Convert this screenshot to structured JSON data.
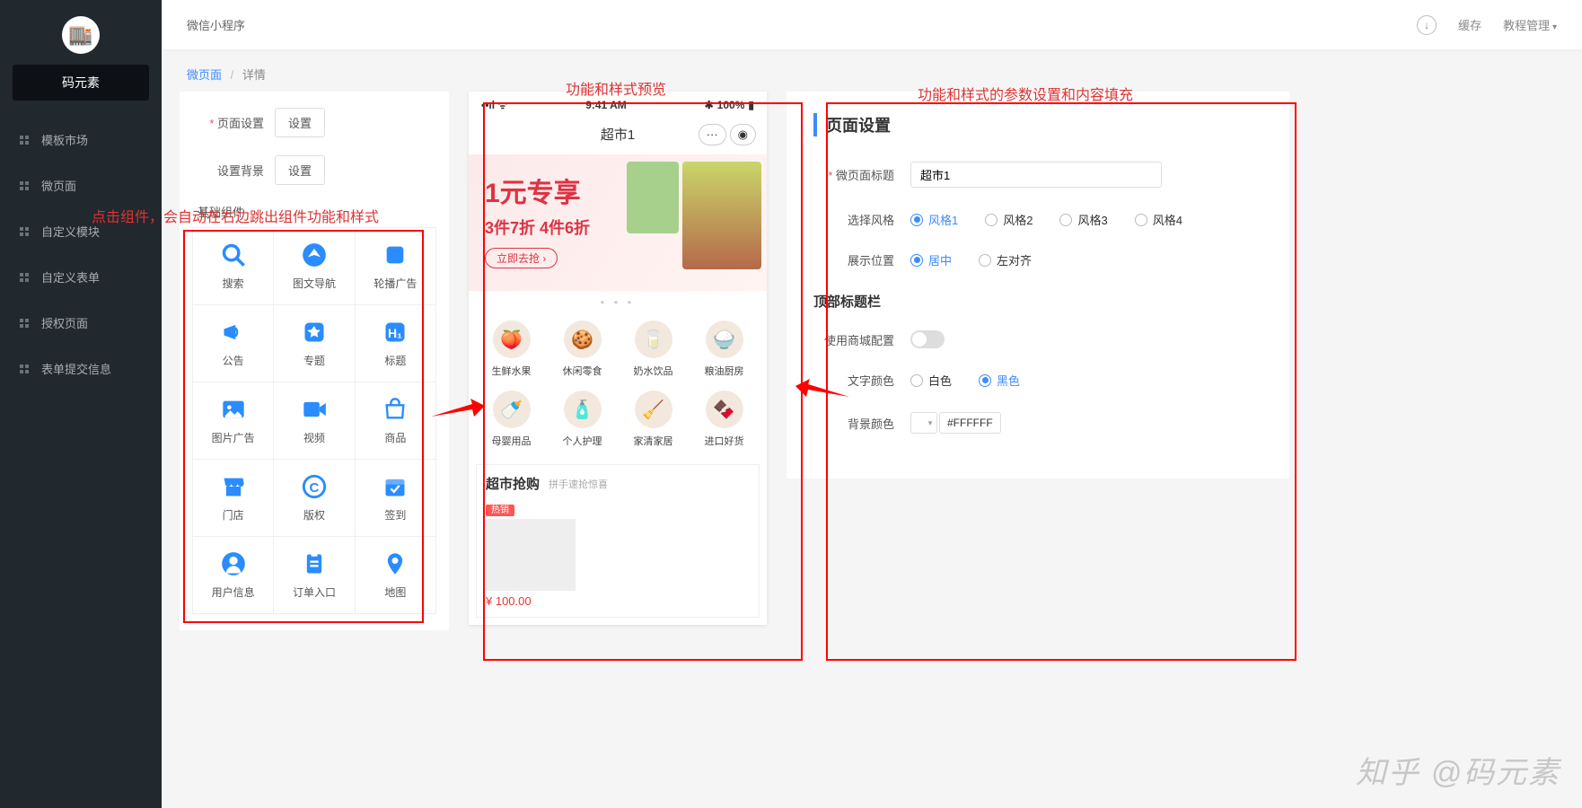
{
  "sidebar": {
    "brand": "码元素",
    "items": [
      {
        "label": "模板市场"
      },
      {
        "label": "微页面"
      },
      {
        "label": "自定义模块"
      },
      {
        "label": "自定义表单"
      },
      {
        "label": "授权页面"
      },
      {
        "label": "表单提交信息"
      }
    ]
  },
  "topbar": {
    "title": "微信小程序",
    "cache": "缓存",
    "tutorial": "教程管理"
  },
  "breadcrumb": {
    "link": "微页面",
    "current": "详情"
  },
  "leftForm": {
    "pageSettingLabel": "页面设置",
    "pageSettingBtn": "设置",
    "bgLabel": "设置背景",
    "bgBtn": "设置"
  },
  "annotations": {
    "click": "点击组件，会自动在右边跳出组件功能和样式",
    "preview": "功能和样式预览",
    "params": "功能和样式的参数设置和内容填充"
  },
  "componentsTitle": "基础组件",
  "components": [
    {
      "label": "搜索",
      "icon": "search"
    },
    {
      "label": "图文导航",
      "icon": "nav"
    },
    {
      "label": "轮播广告",
      "icon": "carousel"
    },
    {
      "label": "公告",
      "icon": "announce"
    },
    {
      "label": "专题",
      "icon": "star"
    },
    {
      "label": "标题",
      "icon": "heading"
    },
    {
      "label": "图片广告",
      "icon": "image"
    },
    {
      "label": "视频",
      "icon": "video"
    },
    {
      "label": "商品",
      "icon": "goods"
    },
    {
      "label": "门店",
      "icon": "store"
    },
    {
      "label": "版权",
      "icon": "copyright"
    },
    {
      "label": "签到",
      "icon": "checkin"
    },
    {
      "label": "用户信息",
      "icon": "user"
    },
    {
      "label": "订单入口",
      "icon": "order"
    },
    {
      "label": "地图",
      "icon": "map"
    }
  ],
  "phone": {
    "time": "9:41 AM",
    "battery": "100%",
    "title": "超市1",
    "bannerTitle": "1元专享",
    "bannerSub": "3件7折 4件6折",
    "bannerCta": "立即去抢 ›",
    "categories": [
      {
        "label": "生鲜水果"
      },
      {
        "label": "休闲零食"
      },
      {
        "label": "奶水饮品"
      },
      {
        "label": "粮油厨房"
      },
      {
        "label": "母婴用品"
      },
      {
        "label": "个人护理"
      },
      {
        "label": "家清家居"
      },
      {
        "label": "进口好货"
      }
    ],
    "promoTitle": "超市抢购",
    "promoSub": "拼手速抢惊喜",
    "badge": "热销",
    "price": "¥ 100.00"
  },
  "settings": {
    "sectionTitle": "页面设置",
    "titleLabel": "微页面标题",
    "titleVal": "超市1",
    "styleLabel": "选择风格",
    "styles": [
      "风格1",
      "风格2",
      "风格3",
      "风格4"
    ],
    "styleSelected": 0,
    "posLabel": "展示位置",
    "positions": [
      "居中",
      "左对齐"
    ],
    "posSelected": 0,
    "topbarSection": "顶部标题栏",
    "useMallLabel": "使用商城配置",
    "textColorLabel": "文字颜色",
    "textColors": [
      "白色",
      "黑色"
    ],
    "textColorSelected": 1,
    "bgColorLabel": "背景颜色",
    "bgColorVal": "#FFFFFF"
  },
  "watermark": "知乎 @码元素"
}
